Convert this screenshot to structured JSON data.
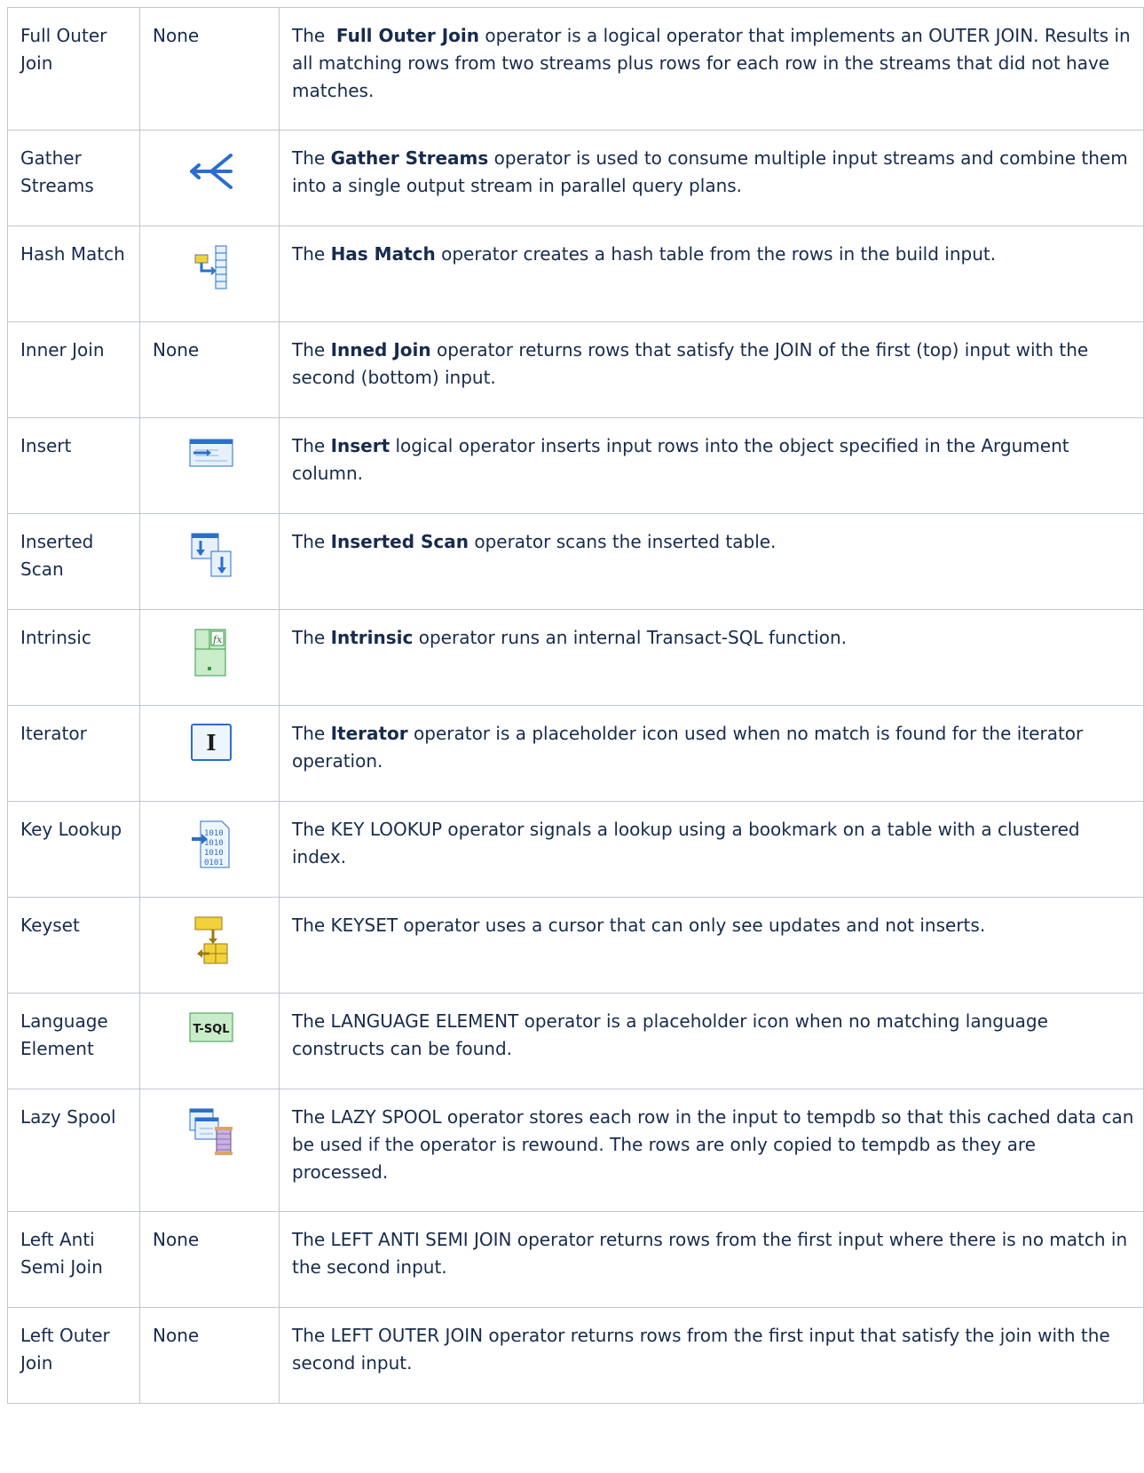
{
  "rows": [
    {
      "name": "Full Outer Join",
      "icon_text": "None",
      "icon": null,
      "d1": "The ",
      "lead_space": true,
      "bold": "Full Outer Join",
      "d2": " operator is a logical operator that implements an OUTER JOIN. Results in all matching rows from two streams plus rows for each row in the streams that did not have matches."
    },
    {
      "name": "Gather Streams",
      "icon_text": "",
      "icon": "gather-streams-icon",
      "d1": "The ",
      "bold": "Gather Streams",
      "d2": " operator is used to consume multiple input streams and combine them into a single output stream in parallel query plans."
    },
    {
      "name": "Hash Match",
      "icon_text": "",
      "icon": "hash-match-icon",
      "d1": "The ",
      "bold": "Has Match",
      "d2": " operator creates a hash table from the rows in the build input."
    },
    {
      "name": "Inner Join",
      "icon_text": "None",
      "icon": null,
      "d1": "The ",
      "bold": "Inned Join",
      "d2": " operator returns rows that satisfy the JOIN of the first (top) input with the second (bottom) input."
    },
    {
      "name": "Insert",
      "icon_text": "",
      "icon": "insert-icon",
      "d1": "The ",
      "bold": "Insert",
      "d2": " logical operator inserts input rows into the object specified in the Argument column."
    },
    {
      "name": "Inserted Scan",
      "icon_text": "",
      "icon": "inserted-scan-icon",
      "d1": "The ",
      "bold": "Inserted Scan",
      "d2": " operator scans the inserted table."
    },
    {
      "name": "Intrinsic",
      "icon_text": "",
      "icon": "intrinsic-icon",
      "d1": "The ",
      "bold": "Intrinsic",
      "d2": " operator runs an internal Transact-SQL function."
    },
    {
      "name": "Iterator",
      "icon_text": "",
      "icon": "iterator-icon",
      "d1": "The ",
      "bold": "Iterator",
      "d2": " operator is a placeholder icon used when no match is found for the iterator operation."
    },
    {
      "name": "Key Lookup",
      "icon_text": "",
      "icon": "key-lookup-icon",
      "d1": "The KEY LOOKUP operator signals a lookup using a bookmark on a table with a clustered index.",
      "bold": "",
      "d2": ""
    },
    {
      "name": "Keyset",
      "icon_text": "",
      "icon": "keyset-icon",
      "d1": "The KEYSET operator uses a cursor that can only see updates and not inserts.",
      "bold": "",
      "d2": ""
    },
    {
      "name": "Language Element",
      "icon_text": "",
      "icon": "language-element-icon",
      "icon_label": "T-SQL",
      "d1": "The LANGUAGE ELEMENT operator is a placeholder icon when no matching language constructs can be found.",
      "bold": "",
      "d2": ""
    },
    {
      "name": "Lazy Spool",
      "icon_text": "",
      "icon": "lazy-spool-icon",
      "d1": "The LAZY SPOOL operator stores each row in the input to tempdb so that this cached data can be used if the operator is rewound. The rows are only copied to tempdb as they are processed.",
      "bold": "",
      "d2": ""
    },
    {
      "name": "Left Anti Semi Join",
      "icon_text": "None",
      "icon": null,
      "d1": "The LEFT ANTI SEMI JOIN operator returns rows from the first input where there is no match in the second input.",
      "bold": "",
      "d2": ""
    },
    {
      "name": "Left Outer Join",
      "icon_text": "None",
      "icon": null,
      "d1": "The LEFT OUTER JOIN operator returns rows from the first input that satisfy the join with the second input.",
      "bold": "",
      "d2": ""
    }
  ],
  "colors": {
    "border": "#c1c7d0",
    "text": "#172b4d",
    "icon_blue": "#2a6fc9",
    "icon_green": "#3a9a4a",
    "icon_gold": "#d4a21a"
  }
}
